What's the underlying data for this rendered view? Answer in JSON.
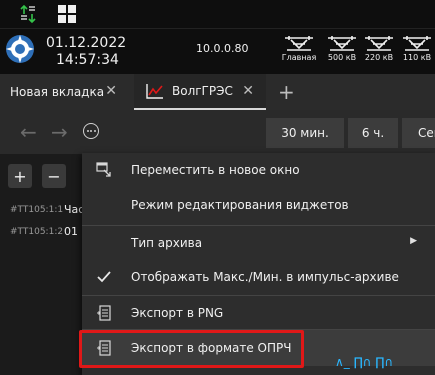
{
  "topbar": {
    "icons": [
      "sort-arrows-icon",
      "grid-icon"
    ]
  },
  "header": {
    "date": "01.12.2022",
    "time": "14:57:34",
    "ip": "10.0.0.80",
    "breakers": [
      {
        "label": "Главная",
        "icon": "breaker-icon"
      },
      {
        "label": "500 кВ",
        "icon": "breaker-icon"
      },
      {
        "label": "220 кВ",
        "icon": "breaker-icon"
      },
      {
        "label": "110 кВ",
        "icon": "breaker-icon"
      }
    ]
  },
  "tabs": [
    {
      "label": "Новая вкладка",
      "close": "✕"
    },
    {
      "label": "ВолгГРЭС",
      "close": "✕",
      "active": true
    }
  ],
  "add_tab": "+",
  "toolbar": {
    "back": "←",
    "forward": "→",
    "periods": [
      "30 мин.",
      "6 ч.",
      "Сег"
    ]
  },
  "left_panel": {
    "add": "+",
    "remove": "−",
    "rows": [
      {
        "id": "#TT105:1:1",
        "value": "Час"
      },
      {
        "id": "#TT105:1:2",
        "value": "01"
      }
    ]
  },
  "context_menu": {
    "items": [
      {
        "label": "Переместить в новое окно",
        "icon": "move-window-icon"
      },
      {
        "label": "Режим редактирования виджетов",
        "icon": ""
      },
      {
        "label": "Тип архива",
        "icon": "",
        "submenu": "▶"
      },
      {
        "label": "Отображать Макс./Мин. в импульс-архиве",
        "icon": "checkmark-icon"
      },
      {
        "label": "Экспорт в PNG",
        "icon": "export-document-icon"
      },
      {
        "label": "Экспорт в формате ОПРЧ",
        "icon": "export-document-icon",
        "highlighted": true
      }
    ]
  },
  "chart_glimpse": "∧_ ∏∩ ∏∩",
  "colors": {
    "background": "#1e1e1e",
    "menu": "#2d2d2d",
    "highlight_box": "#e01818",
    "icon_green": "#35c24a",
    "chart_line": "#2ab7ff"
  }
}
